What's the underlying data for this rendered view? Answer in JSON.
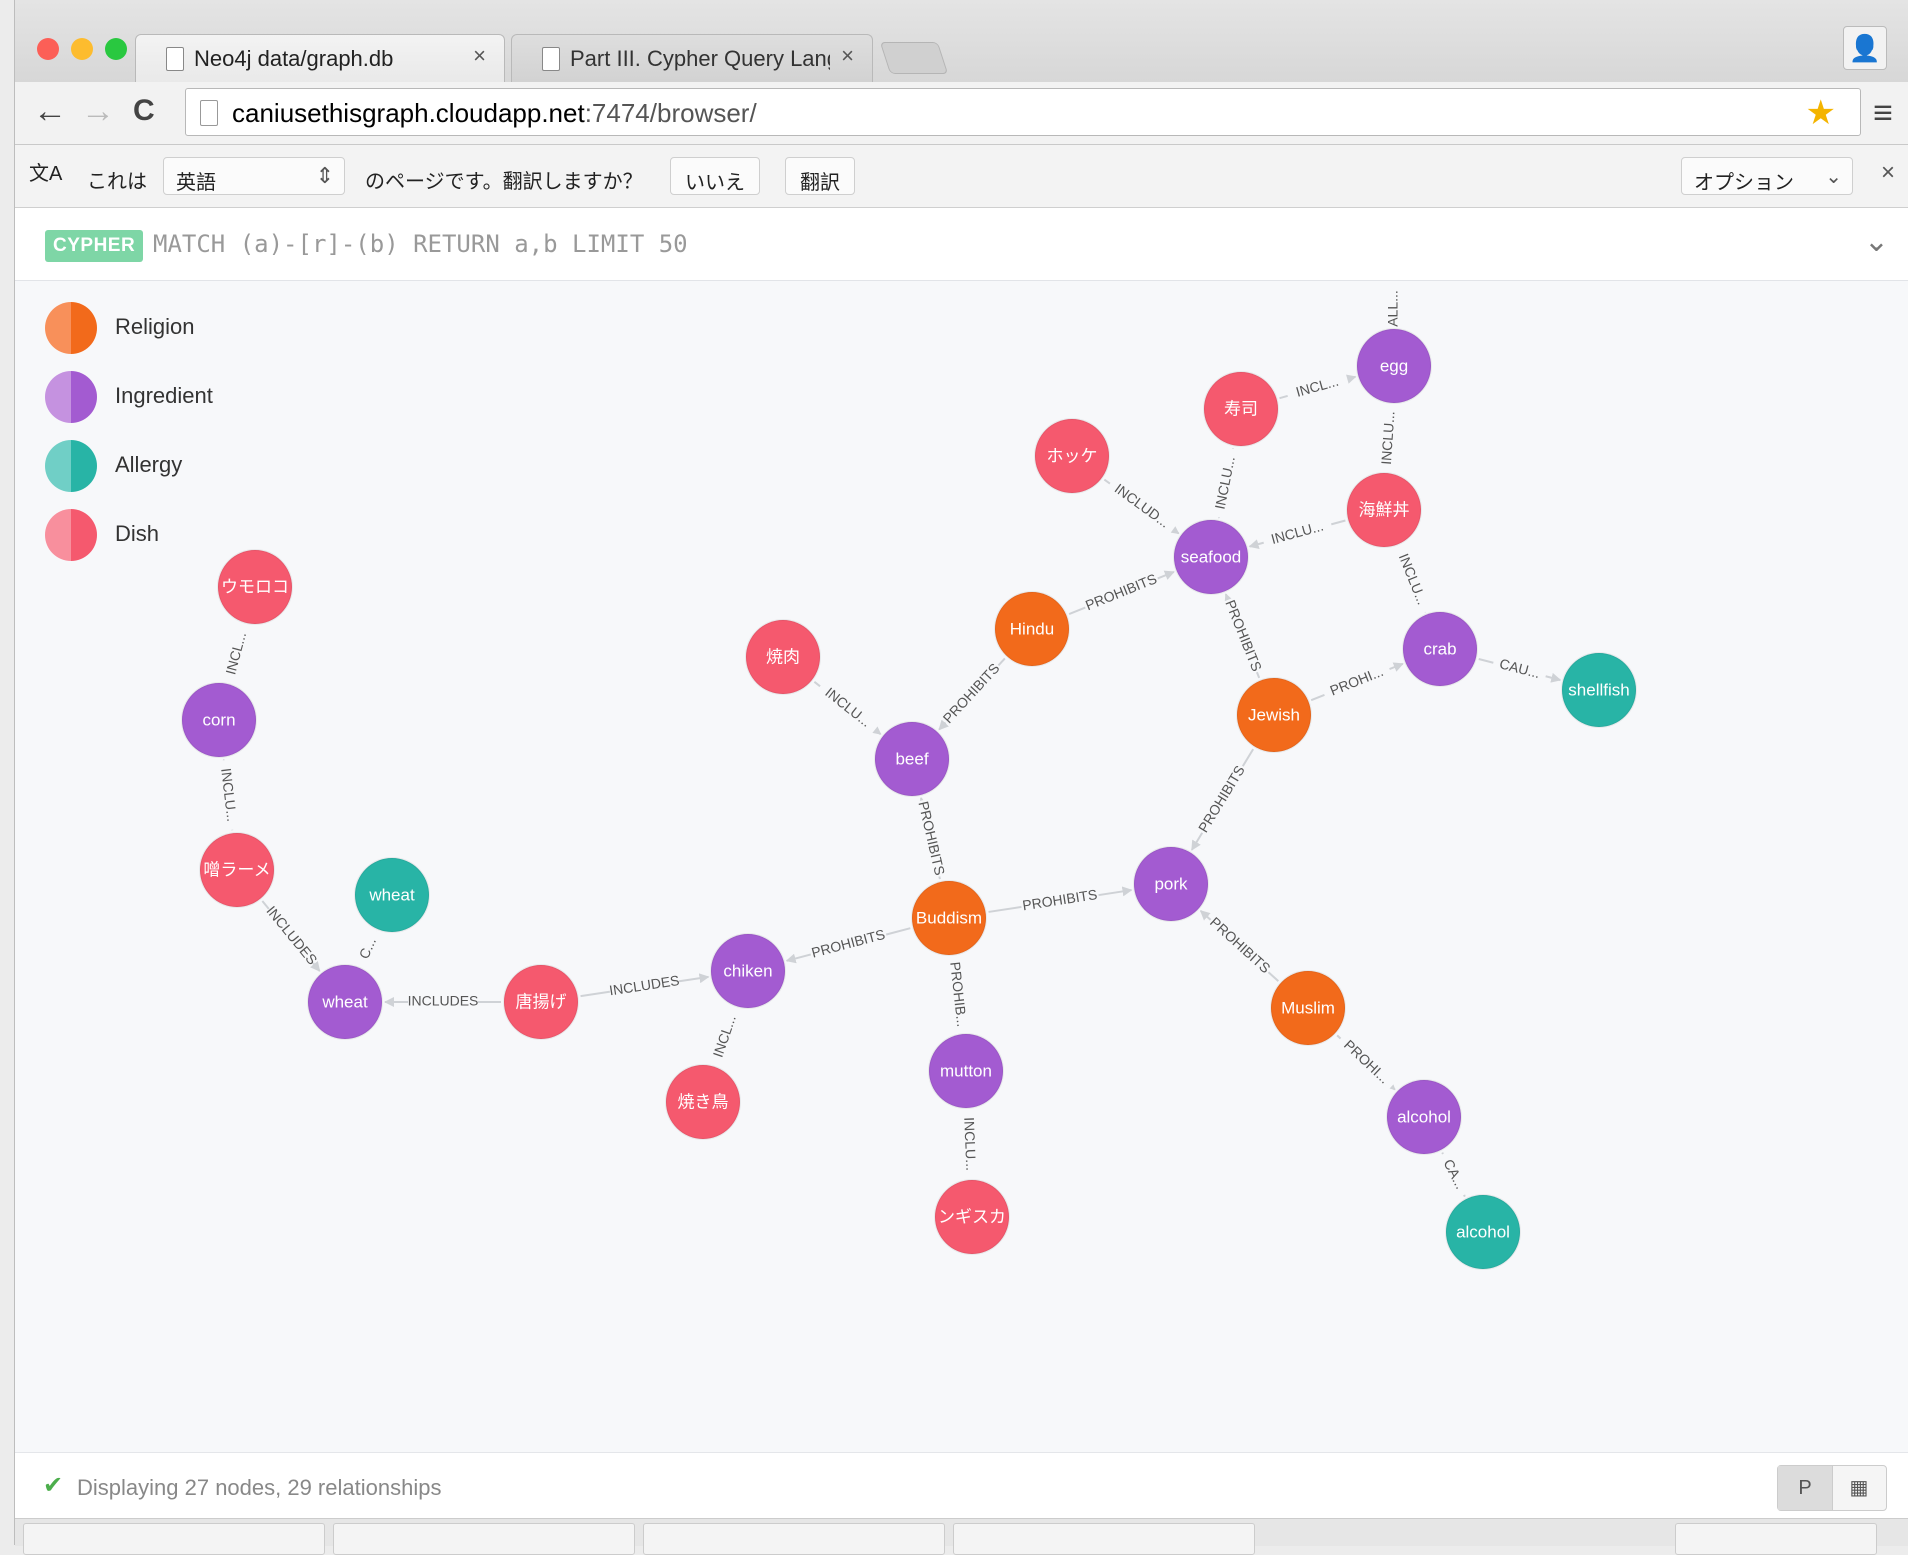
{
  "browser": {
    "tabs": [
      {
        "label": "Neo4j data/graph.db",
        "close": "×"
      },
      {
        "label": "Part III. Cypher Query Lang",
        "close": "×"
      }
    ],
    "url_host": "caniusethisgraph.cloudapp.net",
    "url_rest": ":7474/browser/",
    "back": "←",
    "forward": "→",
    "reload": "C",
    "star": "★",
    "menu": "≡",
    "profile": "👤"
  },
  "translate_bar": {
    "icon_label": "文A",
    "prefix": "これは",
    "language": "英語",
    "suffix": "のページです。翻訳しますか？",
    "no_button": "いいえ",
    "translate_button": "翻訳",
    "options": "オプション",
    "close": "×"
  },
  "cypher": {
    "badge": "CYPHER",
    "query": "MATCH (a)-[r]-(b) RETURN a,b LIMIT 50",
    "collapse_icon": "⌄"
  },
  "colors": {
    "religion": "#f26a1b",
    "religion_light": "#f8905a",
    "ingredient": "#a35bd1",
    "ingredient_light": "#c592e0",
    "allergy": "#28b4a6",
    "allergy_light": "#70cfc6",
    "dish": "#f5596e",
    "dish_light": "#f88f9d"
  },
  "legend": [
    {
      "label": "Religion",
      "type": "religion"
    },
    {
      "label": "Ingredient",
      "type": "ingredient"
    },
    {
      "label": "Allergy",
      "type": "allergy"
    },
    {
      "label": "Dish",
      "type": "dish"
    }
  ],
  "graph": {
    "nodes": [
      {
        "id": "egg",
        "label": "egg",
        "type": "ingredient"
      },
      {
        "id": "sushi",
        "label": "寿司",
        "type": "dish"
      },
      {
        "id": "hokke",
        "label": "ホッケ",
        "type": "dish"
      },
      {
        "id": "kaisendon",
        "label": "海鮮丼",
        "type": "dish"
      },
      {
        "id": "seafood",
        "label": "seafood",
        "type": "ingredient"
      },
      {
        "id": "hindu",
        "label": "Hindu",
        "type": "religion"
      },
      {
        "id": "crab",
        "label": "crab",
        "type": "ingredient"
      },
      {
        "id": "shellfish",
        "label": "shellfish",
        "type": "allergy"
      },
      {
        "id": "jewish",
        "label": "Jewish",
        "type": "religion"
      },
      {
        "id": "yakiniku",
        "label": "焼肉",
        "type": "dish"
      },
      {
        "id": "beef",
        "label": "beef",
        "type": "ingredient"
      },
      {
        "id": "pork",
        "label": "pork",
        "type": "ingredient"
      },
      {
        "id": "buddhism",
        "label": "Buddism",
        "type": "religion"
      },
      {
        "id": "muslim",
        "label": "Muslim",
        "type": "religion"
      },
      {
        "id": "alcohol_i",
        "label": "alcohol",
        "type": "ingredient"
      },
      {
        "id": "alcohol_a",
        "label": "alcohol",
        "type": "allergy"
      },
      {
        "id": "mutton",
        "label": "mutton",
        "type": "ingredient"
      },
      {
        "id": "jingisukan",
        "label": "ンギスカ",
        "type": "dish"
      },
      {
        "id": "chiken",
        "label": "chiken",
        "type": "ingredient"
      },
      {
        "id": "yakitori",
        "label": "焼き鳥",
        "type": "dish"
      },
      {
        "id": "karaage",
        "label": "唐揚げ",
        "type": "dish"
      },
      {
        "id": "wheat_i",
        "label": "wheat",
        "type": "ingredient"
      },
      {
        "id": "wheat_a",
        "label": "wheat",
        "type": "allergy"
      },
      {
        "id": "ramen",
        "label": "噌ラーメ",
        "type": "dish"
      },
      {
        "id": "corn",
        "label": "corn",
        "type": "ingredient"
      },
      {
        "id": "tomorokoshi",
        "label": "ウモロコ",
        "type": "dish"
      }
    ],
    "edges": [
      {
        "from": "egg",
        "to": "top",
        "label": "ALL..."
      },
      {
        "from": "sushi",
        "to": "egg",
        "label": "INCL..."
      },
      {
        "from": "kaisendon",
        "to": "egg",
        "label": "INCLU..."
      },
      {
        "from": "hokke",
        "to": "seafood",
        "label": "INCLUD..."
      },
      {
        "from": "sushi",
        "to": "seafood",
        "label": "INCLU..."
      },
      {
        "from": "kaisendon",
        "to": "seafood",
        "label": "INCLU..."
      },
      {
        "from": "kaisendon",
        "to": "crab",
        "label": "INCLU..."
      },
      {
        "from": "hindu",
        "to": "seafood",
        "label": "PROHIBITS"
      },
      {
        "from": "jewish",
        "to": "seafood",
        "label": "PROHIBITS"
      },
      {
        "from": "jewish",
        "to": "crab",
        "label": "PROHI..."
      },
      {
        "from": "crab",
        "to": "shellfish",
        "label": "CAU..."
      },
      {
        "from": "hindu",
        "to": "beef",
        "label": "PROHIBITS"
      },
      {
        "from": "yakiniku",
        "to": "beef",
        "label": "INCLU..."
      },
      {
        "from": "buddhism",
        "to": "beef",
        "label": "PROHIBITS"
      },
      {
        "from": "jewish",
        "to": "pork",
        "label": "PROHIBITS"
      },
      {
        "from": "buddhism",
        "to": "pork",
        "label": "PROHIBITS"
      },
      {
        "from": "muslim",
        "to": "pork",
        "label": "PROHIBITS"
      },
      {
        "from": "muslim",
        "to": "alcohol_i",
        "label": "PROHI..."
      },
      {
        "from": "alcohol_i",
        "to": "alcohol_a",
        "label": "CA..."
      },
      {
        "from": "buddhism",
        "to": "mutton",
        "label": "PROHIB..."
      },
      {
        "from": "jingisukan",
        "to": "mutton",
        "label": "INCLU..."
      },
      {
        "from": "buddhism",
        "to": "chiken",
        "label": "PROHIBITS"
      },
      {
        "from": "yakitori",
        "to": "chiken",
        "label": "INCL..."
      },
      {
        "from": "karaage",
        "to": "chiken",
        "label": "INCLUDES"
      },
      {
        "from": "karaage",
        "to": "wheat_i",
        "label": "INCLUDES"
      },
      {
        "from": "wheat_i",
        "to": "wheat_a",
        "label": "C..."
      },
      {
        "from": "ramen",
        "to": "wheat_i",
        "label": "INCLUDES"
      },
      {
        "from": "ramen",
        "to": "corn",
        "label": "INCLU..."
      },
      {
        "from": "tomorokoshi",
        "to": "corn",
        "label": "INCL..."
      }
    ]
  },
  "status": {
    "check": "✔",
    "text": "Displaying 27 nodes, 29 relationships",
    "graph_view_icon": "Ρ",
    "table_view_icon": "▦"
  }
}
